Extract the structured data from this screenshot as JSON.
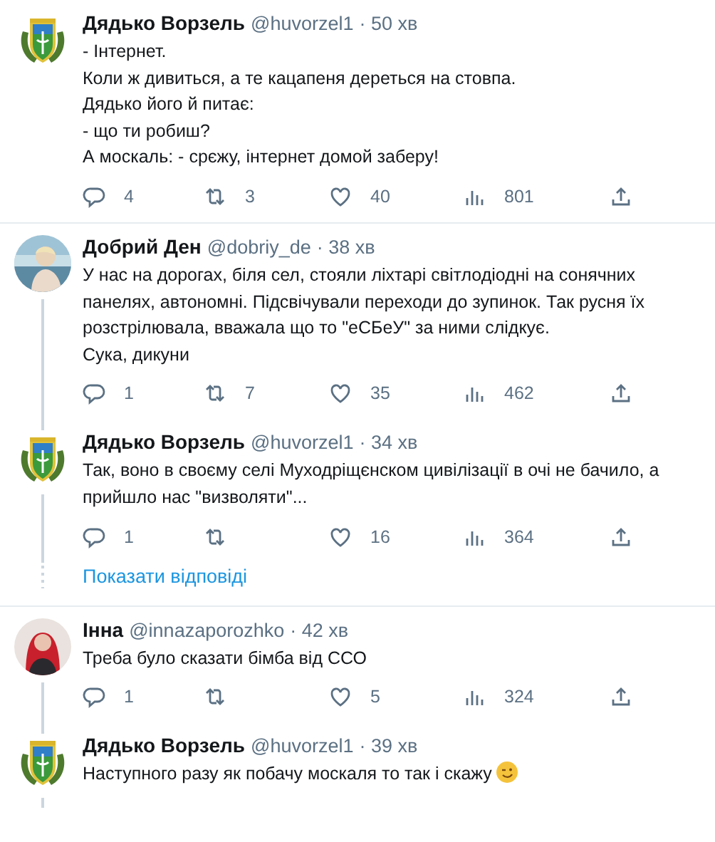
{
  "threads": [
    {
      "tweets": [
        {
          "author": "Дядько Ворзель",
          "handle": "@huvorzel1",
          "time": "· 50 хв",
          "avatar": {
            "kind": "emblem"
          },
          "text_lines": [
            "- Інтернет.",
            "Коли ж дивиться, а те кацапеня дереться на стовпа.",
            "Дядько його й питає:",
            "- що ти робиш?",
            "А москаль: - срєжу, інтернет домой заберу!"
          ],
          "stats": {
            "replies": "4",
            "retweets": "3",
            "likes": "40",
            "views": "801"
          }
        }
      ]
    },
    {
      "tweets": [
        {
          "author": "Добрий Ден",
          "handle": "@dobriy_de",
          "time": "· 38 хв",
          "avatar": {
            "kind": "photo_light"
          },
          "text_lines": [
            "У нас на дорогах, біля сел, стояли ліхтарі світлодіодні на сонячних панелях, автономні. Підсвічували переходи до зупинок. Так русня їх розстрілювала, вважала що то \"еСБеУ\" за ними слідкує.",
            "Сука, дикуни"
          ],
          "stats": {
            "replies": "1",
            "retweets": "7",
            "likes": "35",
            "views": "462"
          }
        },
        {
          "author": "Дядько Ворзель",
          "handle": "@huvorzel1",
          "time": "· 34 хв",
          "avatar": {
            "kind": "emblem"
          },
          "text_lines": [
            "Так, воно в своєму селі Муходріщєнском цивілізації в очі не бачило, а прийшло нас \"визволяти\"..."
          ],
          "stats": {
            "replies": "1",
            "likes": "16",
            "views": "364"
          }
        }
      ],
      "show_replies": "Показати відповіді"
    },
    {
      "tweets": [
        {
          "author": "Інна",
          "handle": "@innazaporozhko",
          "time": "· 42 хв",
          "avatar": {
            "kind": "photo_red"
          },
          "text_lines": [
            "Треба було сказати бімба від ССО"
          ],
          "stats": {
            "replies": "1",
            "likes": "5",
            "views": "324"
          }
        },
        {
          "author": "Дядько Ворзель",
          "handle": "@huvorzel1",
          "time": "· 39 хв",
          "avatar": {
            "kind": "emblem"
          },
          "text_lines": [
            "Наступного разу як побачу москаля то так і скажу"
          ],
          "emoji": {
            "kind": "wink"
          },
          "continues": true
        }
      ]
    }
  ]
}
